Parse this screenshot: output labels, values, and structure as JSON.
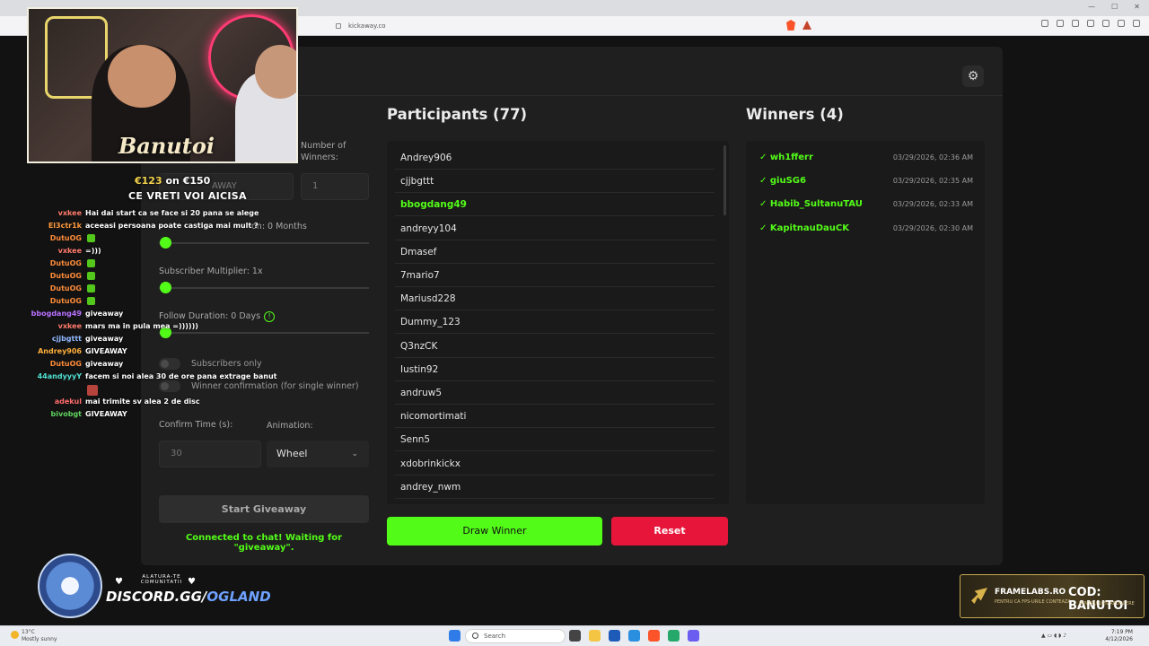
{
  "browser": {
    "url": "kickaway.co"
  },
  "settings": {
    "number_of_winners_label": "Number of Winners:",
    "number_of_winners_value": "1",
    "keyword_partial": "AWAY",
    "subscription_duration_label": "on: 0 Months",
    "subscription_level": 0.0,
    "subscriber_multiplier_label": "Subscriber Multiplier: 1x",
    "subscriber_multiplier_level": 0.0,
    "follow_duration_label": "Follow Duration:  0  Days",
    "follow_duration_level": 0.0,
    "info_icon": "!",
    "subscribers_only_label": "Subscribers only",
    "winner_confirmation_label": "Winner confirmation (for single winner)",
    "confirm_time_label": "Confirm Time (s):",
    "confirm_time_value": "30",
    "animation_label": "Animation:",
    "animation_value": "Wheel",
    "start_button": "Start Giveaway",
    "status": "Connected to chat! Waiting for \"giveaway\"."
  },
  "participants": {
    "title": "Participants (77)",
    "names": [
      "Andrey906",
      "cjjbgttt",
      "bbogdang49",
      "andreyy104",
      "Dmasef",
      "7mario7",
      "Mariusd228",
      "Dummy_123",
      "Q3nzCK",
      "Iustin92",
      "andruw5",
      "nicomortimati",
      "Senn5",
      "xdobrinkickx",
      "andrey_nwm"
    ],
    "highlighted": "bbogdang49",
    "draw_button": "Draw Winner",
    "reset_button": "Reset"
  },
  "winners": {
    "title": "Winners (4)",
    "items": [
      {
        "name": "✓ wh1fferr",
        "time": "03/29/2026, 02:36 AM"
      },
      {
        "name": "✓ giuSG6",
        "time": "03/29/2026, 02:35 AM"
      },
      {
        "name": "✓ Habib_SultanuTAU",
        "time": "03/29/2026, 02:33 AM"
      },
      {
        "name": "✓ KapitnauDauCK",
        "time": "03/29/2026, 02:30 AM"
      }
    ]
  },
  "overlay": {
    "cam_signature": "Banutoi",
    "goal_current": "€123",
    "goal_on": " on ",
    "goal_target": "€150",
    "goal_subtitle": "CE VRETI VOI AICISA",
    "chat": [
      {
        "user": "vxkee",
        "color": "#ff7a6b",
        "msg": "Hai dai start ca se face si 20 pana se alege"
      },
      {
        "user": "El3ctr1k",
        "color": "#ff9a3c",
        "msg": "aceeasi persoana poate castiga mai mult ?"
      },
      {
        "user": "DutuOG",
        "color": "#ff8c3a",
        "msg": "",
        "emote": true
      },
      {
        "user": "vxkee",
        "color": "#ff7a6b",
        "msg": "=)))"
      },
      {
        "user": "DutuOG",
        "color": "#ff8c3a",
        "msg": "",
        "emote": true
      },
      {
        "user": "DutuOG",
        "color": "#ff8c3a",
        "msg": "",
        "emote": true
      },
      {
        "user": "DutuOG",
        "color": "#ff8c3a",
        "msg": "",
        "emote": true
      },
      {
        "user": "DutuOG",
        "color": "#ff8c3a",
        "msg": "",
        "emote": true
      },
      {
        "user": "bbogdang49",
        "color": "#b770ff",
        "msg": "giveaway"
      },
      {
        "user": "vxkee",
        "color": "#ff7a6b",
        "msg": "mars ma in pula mea =))))))"
      },
      {
        "user": "cjjbgttt",
        "color": "#8fb7ff",
        "msg": "giveaway"
      },
      {
        "user": "Andrey906",
        "color": "#ffb03b",
        "msg": "GIVEAWAY"
      },
      {
        "user": "DutuOG",
        "color": "#ff8c3a",
        "msg": "giveaway"
      },
      {
        "user": "44andyyyY",
        "color": "#4fe0d0",
        "msg": "facem si noi alea 30 de ore pana extrage banut"
      },
      {
        "user": "",
        "color": "#ffffff",
        "msg": "",
        "emote_red": true
      },
      {
        "user": "adekul",
        "color": "#ff6b6b",
        "msg": "mai trimite sv alea 2 de disc"
      },
      {
        "user": "bivobgt",
        "color": "#5fd35f",
        "msg": "GIVEAWAY"
      }
    ],
    "discord_join": "ALATURA-TE COMUNITATII",
    "discord_prefix": "DISCORD.GG/",
    "discord_code": "OGLAND",
    "banner_brand": "FRAMELABS.RO",
    "banner_brand_sub": "PENTRU CA FPS-URILE CONTEAZA",
    "banner_code": "COD: BANUTOI",
    "banner_code_sub": "PENTRU 10% REDUCERE"
  },
  "taskbar": {
    "weather_temp": "13°C",
    "weather_desc": "Mostly sunny",
    "search": "Search",
    "time": "7:19 PM",
    "date": "4/12/2026"
  },
  "colors": {
    "accent": "#53fc18",
    "danger": "#e8153b",
    "panel": "#1f1f1f"
  }
}
